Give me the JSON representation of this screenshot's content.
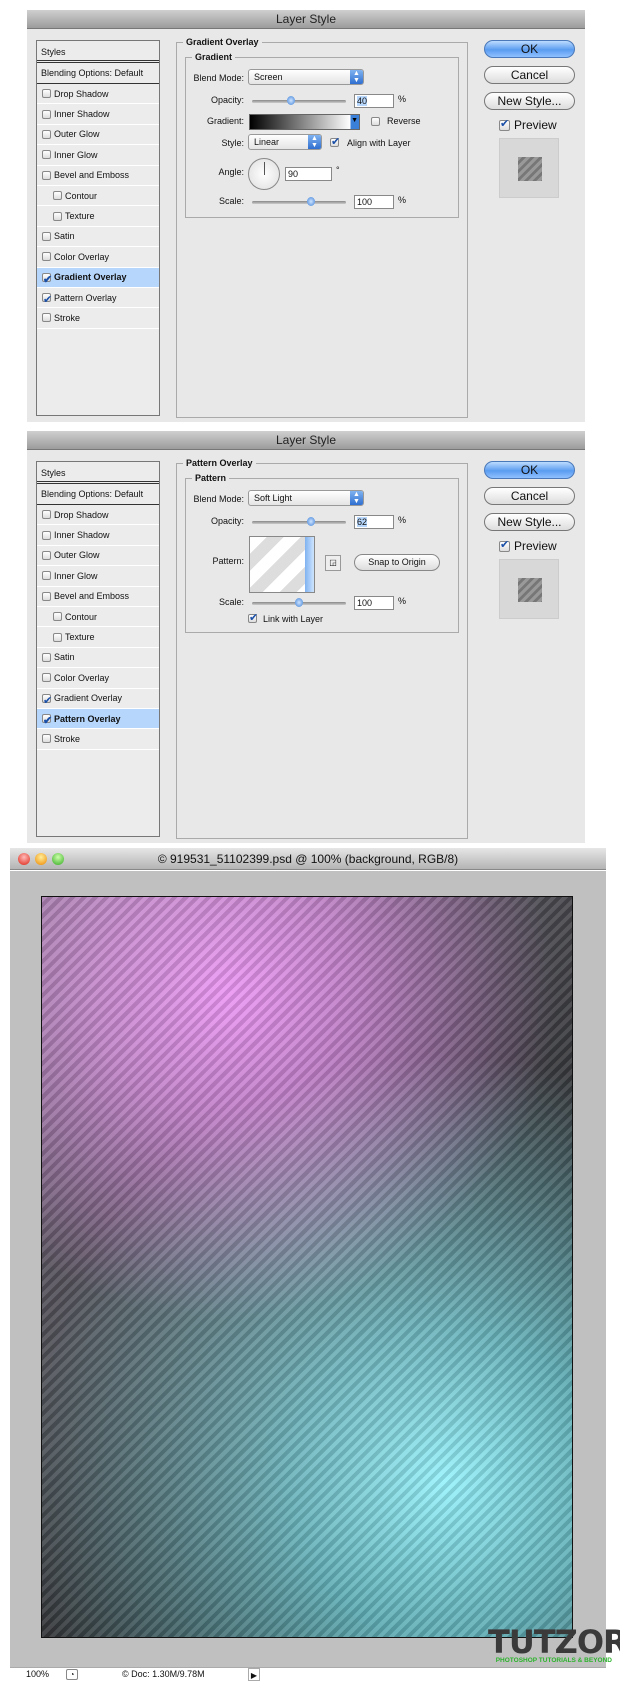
{
  "dialogs": [
    {
      "title": "Layer Style",
      "section": "Gradient Overlay",
      "group": "Gradient",
      "styles_header": "Styles",
      "blending": "Blending Options: Default",
      "items": [
        {
          "label": "Drop Shadow",
          "checked": false
        },
        {
          "label": "Inner Shadow",
          "checked": false
        },
        {
          "label": "Outer Glow",
          "checked": false
        },
        {
          "label": "Inner Glow",
          "checked": false
        },
        {
          "label": "Bevel and Emboss",
          "checked": false
        },
        {
          "label": "Contour",
          "checked": false,
          "sub": true
        },
        {
          "label": "Texture",
          "checked": false,
          "sub": true
        },
        {
          "label": "Satin",
          "checked": false
        },
        {
          "label": "Color Overlay",
          "checked": false
        },
        {
          "label": "Gradient Overlay",
          "checked": true,
          "selected": true
        },
        {
          "label": "Pattern Overlay",
          "checked": true
        },
        {
          "label": "Stroke",
          "checked": false
        }
      ],
      "blend_mode_label": "Blend Mode:",
      "blend_mode": "Screen",
      "opacity_label": "Opacity:",
      "opacity": "40",
      "opacity_unit": "%",
      "gradient_label": "Gradient:",
      "reverse_label": "Reverse",
      "reverse": false,
      "style_label": "Style:",
      "style": "Linear",
      "align_label": "Align with Layer",
      "align": true,
      "angle_label": "Angle:",
      "angle": "90",
      "angle_unit": "°",
      "scale_label": "Scale:",
      "scale": "100",
      "scale_unit": "%"
    },
    {
      "title": "Layer Style",
      "section": "Pattern Overlay",
      "group": "Pattern",
      "styles_header": "Styles",
      "blending": "Blending Options: Default",
      "items": [
        {
          "label": "Drop Shadow",
          "checked": false
        },
        {
          "label": "Inner Shadow",
          "checked": false
        },
        {
          "label": "Outer Glow",
          "checked": false
        },
        {
          "label": "Inner Glow",
          "checked": false
        },
        {
          "label": "Bevel and Emboss",
          "checked": false
        },
        {
          "label": "Contour",
          "checked": false,
          "sub": true
        },
        {
          "label": "Texture",
          "checked": false,
          "sub": true
        },
        {
          "label": "Satin",
          "checked": false
        },
        {
          "label": "Color Overlay",
          "checked": false
        },
        {
          "label": "Gradient Overlay",
          "checked": true
        },
        {
          "label": "Pattern Overlay",
          "checked": true,
          "selected": true
        },
        {
          "label": "Stroke",
          "checked": false
        }
      ],
      "blend_mode_label": "Blend Mode:",
      "blend_mode": "Soft Light",
      "opacity_label": "Opacity:",
      "opacity": "62",
      "opacity_unit": "%",
      "pattern_label": "Pattern:",
      "snap_label": "Snap to Origin",
      "scale_label": "Scale:",
      "scale": "100",
      "scale_unit": "%",
      "link_label": "Link with Layer",
      "link": true
    }
  ],
  "buttons": {
    "ok": "OK",
    "cancel": "Cancel",
    "new_style": "New Style...",
    "preview": "Preview"
  },
  "document": {
    "title": "© 919531_51102399.psd @ 100% (background, RGB/8)",
    "zoom": "100%",
    "doc_info": "© Doc: 1.30M/9.78M"
  },
  "watermark": {
    "name": "TUTZOR",
    "tagline": "PHOTOSHOP TUTORIALS & BEYOND"
  },
  "colors": {
    "selection": "#b6d6fb",
    "accent": "#3a7fd8",
    "logo_green": "#2bb32b"
  }
}
